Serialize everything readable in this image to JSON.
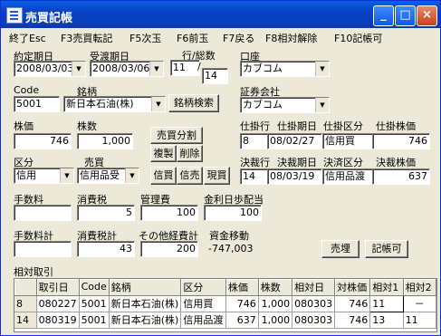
{
  "window": {
    "title": "売買記帳",
    "minimize": "_",
    "maximize": "□",
    "close": "×"
  },
  "menu": [
    "終了Esc",
    "F3売買転記",
    "F5次玉",
    "F6前玉",
    "F7戻る",
    "F8相対解除",
    "F10記帳可"
  ],
  "labels": {
    "yakutei": "約定期日",
    "ukewatashi": "受渡期日",
    "gyo_sosu": "行/総数",
    "koza": "口座",
    "code": "Code",
    "meigara": "銘柄",
    "shoken": "証券会社",
    "kabuka": "株価",
    "kabusu": "株数",
    "kubun": "区分",
    "baibai": "売買",
    "tesuryo": "手数料",
    "shohizei": "消費税",
    "kanrihi": "管理費",
    "kinri": "金利日歩配当",
    "tesuryo_kei": "手数料計",
    "shohizei_kei": "消費税計",
    "sonota": "その他経費計",
    "shikin": "資金移動",
    "shikake_gyo": "仕掛行",
    "shikake_kijitsu": "仕掛期日",
    "shikake_kubun": "仕掛区分",
    "shikake_kabuka": "仕掛株価",
    "kessai_gyo": "決裁行",
    "kessai_kijitsu": "決裁期日",
    "kessai_kubun": "決済区分",
    "kessai_kabuka": "決裁株価",
    "sotai": "相対取引"
  },
  "fields": {
    "yakutei": "2008/03/03",
    "ukewatashi": "2008/03/06",
    "gyo": "11",
    "slash": "/",
    "sosu": "14",
    "koza": "カブコム",
    "code": "5001",
    "meigara": "新日本石油(株)",
    "shoken": "カブコム",
    "kabuka": "746",
    "kabusu": "1,000",
    "kubun": "信用",
    "baibai": "信用品受",
    "tesuryo": "",
    "shohizei": "5",
    "kanrihi": "100",
    "kinri": "100",
    "tesuryo_kei": "",
    "shohizei_kei": "43",
    "sonota": "200",
    "shikin": "-747,003",
    "shikake_gyo": "8",
    "shikake_kijitsu": "08/02/27",
    "shikake_kubun": "信用買",
    "shikake_kabuka": "746",
    "kessai_gyo": "14",
    "kessai_kijitsu": "08/03/19",
    "kessai_kubun": "信用品渡",
    "kessai_kabuka": "637"
  },
  "buttons": {
    "meigara_kensaku": "銘柄検索",
    "baibai_bunkatsu": "売買分割",
    "fukusei": "複製",
    "sakujo": "削除",
    "shinyo_kai": "信買",
    "shinyo_uri": "信売",
    "genkai": "現買",
    "baiten": "売埋",
    "kicho_ka": "記帳可"
  },
  "table": {
    "headers": [
      "",
      "取引日",
      "Code",
      "銘柄",
      "区分",
      "株価",
      "株数",
      "相対日",
      "対株価",
      "相対1",
      "相対2"
    ],
    "rows": [
      [
        "8",
        "080227",
        "5001",
        "新日本石油(株)",
        "信用買",
        "746",
        "1,000",
        "080303",
        "746",
        "11",
        "－"
      ],
      [
        "14",
        "080319",
        "5001",
        "新日本石油(株)",
        "信用品渡",
        "637",
        "1,000",
        "080303",
        "746",
        "13",
        "11"
      ]
    ]
  }
}
